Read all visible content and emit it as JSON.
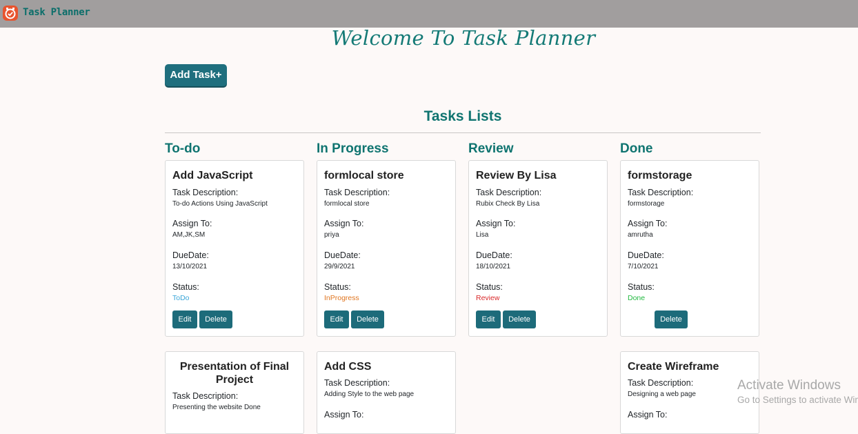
{
  "navbar": {
    "brand": "Task Planner"
  },
  "header": {
    "welcome": "Welcome To Task Planner",
    "add_task_label": "Add Task+"
  },
  "lists": {
    "title": "Tasks Lists",
    "columns": [
      {
        "title": "To-do",
        "cards": [
          {
            "title": "Add JavaScript",
            "desc_label": "Task Description:",
            "desc": "To-do Actions Using JavaScript",
            "assign_label": "Assign To:",
            "assign": "AM,JK,SM",
            "due_label": "DueDate:",
            "due": "13/10/2021",
            "status_label": "Status:",
            "status": "ToDo",
            "edit": "Edit",
            "delete": "Delete"
          },
          {
            "title": "Presentation of Final Project",
            "desc_label": "Task Description:",
            "desc": "Presenting the website Done"
          }
        ]
      },
      {
        "title": "In Progress",
        "cards": [
          {
            "title": "formlocal store",
            "desc_label": "Task Description:",
            "desc": "formlocal store",
            "assign_label": "Assign To:",
            "assign": "priya",
            "due_label": "DueDate:",
            "due": "29/9/2021",
            "status_label": "Status:",
            "status": "InProgress",
            "edit": "Edit",
            "delete": "Delete"
          },
          {
            "title": "Add CSS",
            "desc_label": "Task Description:",
            "desc": "Adding Style to the web page",
            "assign_label": "Assign To:"
          }
        ]
      },
      {
        "title": "Review",
        "cards": [
          {
            "title": "Review By Lisa",
            "desc_label": "Task Description:",
            "desc": "Rubix Check By Lisa",
            "assign_label": "Assign To:",
            "assign": "Lisa",
            "due_label": "DueDate:",
            "due": "18/10/2021",
            "status_label": "Status:",
            "status": "Review",
            "edit": "Edit",
            "delete": "Delete"
          }
        ]
      },
      {
        "title": "Done",
        "cards": [
          {
            "title": "formstorage",
            "desc_label": "Task Description:",
            "desc": "formstorage",
            "assign_label": "Assign To:",
            "assign": "amrutha",
            "due_label": "DueDate:",
            "due": "7/10/2021",
            "status_label": "Status:",
            "status": "Done",
            "delete": "Delete"
          },
          {
            "title": "Create Wireframe",
            "desc_label": "Task Description:",
            "desc": "Designing a web page",
            "assign_label": "Assign To:"
          }
        ]
      }
    ]
  },
  "status_colors": {
    "ToDo": "#3aa6d8",
    "InProgress": "#e0751f",
    "Review": "#d9292b",
    "Done": "#21b83f"
  },
  "watermark": {
    "line1": "Activate Windows",
    "line2": "Go to Settings to activate Windows."
  }
}
